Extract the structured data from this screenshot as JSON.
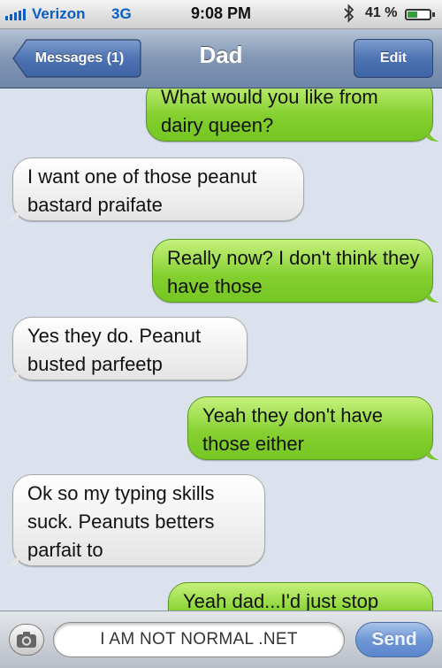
{
  "status_bar": {
    "carrier": "Verizon",
    "network": "3G",
    "time": "9:08 PM",
    "battery_percent": "41 %",
    "battery_level": 0.41,
    "icons": [
      "signal-icon",
      "bluetooth-icon",
      "battery-icon"
    ]
  },
  "nav": {
    "back_label": "Messages (1)",
    "title": "Dad",
    "edit_label": "Edit"
  },
  "messages": [
    {
      "from": "me",
      "text": "What would you like from dairy queen?"
    },
    {
      "from": "dad",
      "text": "I want one of those peanut bastard praifate"
    },
    {
      "from": "me",
      "text": "Really now? I don't think they have those"
    },
    {
      "from": "dad",
      "text": "Yes they do. Peanut busted parfeetp"
    },
    {
      "from": "me",
      "text": "Yeah they don't have those either"
    },
    {
      "from": "dad",
      "text": "Ok so my typing skills suck. Peanuts betters parfait to"
    },
    {
      "from": "me",
      "text": "Yeah dad...I'd just stop"
    }
  ],
  "input": {
    "field_text": "I AM NOT NORMAL .NET",
    "send_label": "Send",
    "camera_icon": "camera-icon"
  },
  "colors": {
    "outgoing_bubble": "#83cf2e",
    "incoming_bubble": "#ffffff",
    "nav_bar": "#8297b5",
    "background": "#dbe2ed"
  }
}
